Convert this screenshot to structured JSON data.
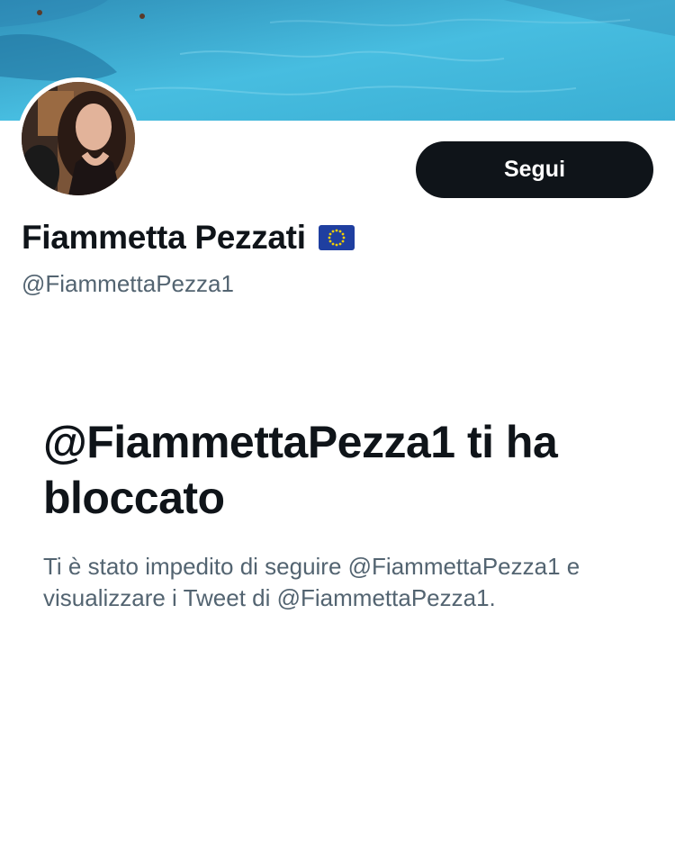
{
  "profile": {
    "display_name": "Fiammetta Pezzati",
    "flag_icon": "eu-flag-icon",
    "handle": "@FiammettaPezza1"
  },
  "actions": {
    "follow_label": "Segui"
  },
  "blocked_notice": {
    "title": "@FiammettaPezza1 ti ha bloccato",
    "description": "Ti è stato impedito di seguire @FiammettaPezza1 e visualizzare i Tweet di @FiammettaPezza1."
  },
  "colors": {
    "primary_text": "#0f1419",
    "secondary_text": "#536471",
    "button_bg": "#0f1419",
    "button_text": "#ffffff",
    "banner_water": "#3db4d8"
  }
}
